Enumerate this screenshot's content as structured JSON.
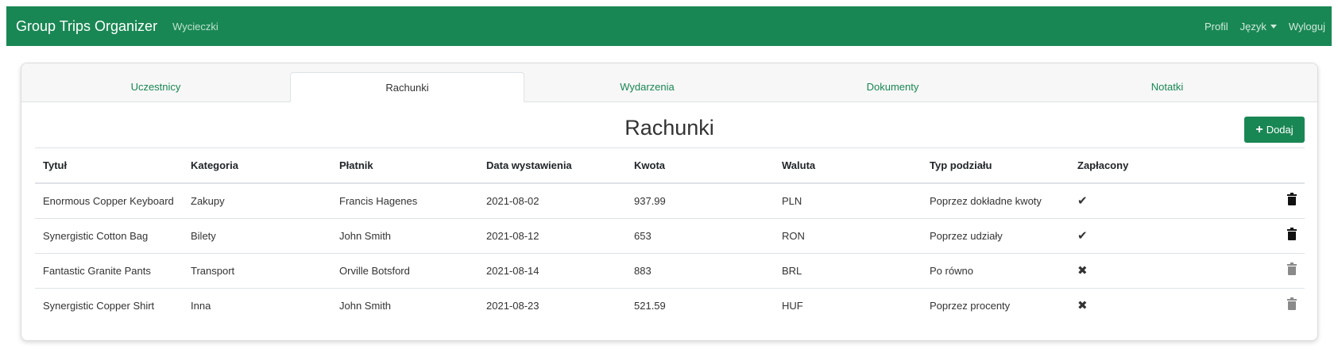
{
  "navbar": {
    "brand": "Group Trips Organizer",
    "trips_link": "Wycieczki",
    "profile": "Profil",
    "language": "Język",
    "logout": "Wyloguj"
  },
  "tabs": [
    "Uczestnicy",
    "Rachunki",
    "Wydarzenia",
    "Dokumenty",
    "Notatki"
  ],
  "active_tab": "Rachunki",
  "page": {
    "title": "Rachunki",
    "add_button": "Dodaj"
  },
  "table": {
    "headers": [
      "Tytuł",
      "Kategoria",
      "Płatnik",
      "Data wystawienia",
      "Kwota",
      "Waluta",
      "Typ podziału",
      "Zapłacony"
    ],
    "rows": [
      {
        "title": "Enormous Copper Keyboard",
        "category": "Zakupy",
        "payer": "Francis Hagenes",
        "date": "2021-08-02",
        "amount": "937.99",
        "currency": "PLN",
        "split": "Poprzez dokładne kwoty",
        "paid": "✔",
        "delete_enabled": true
      },
      {
        "title": "Synergistic Cotton Bag",
        "category": "Bilety",
        "payer": "John Smith",
        "date": "2021-08-12",
        "amount": "653",
        "currency": "RON",
        "split": "Poprzez udziały",
        "paid": "✔",
        "delete_enabled": true
      },
      {
        "title": "Fantastic Granite Pants",
        "category": "Transport",
        "payer": "Orville Botsford",
        "date": "2021-08-14",
        "amount": "883",
        "currency": "BRL",
        "split": "Po równo",
        "paid": "✖",
        "delete_enabled": false
      },
      {
        "title": "Synergistic Copper Shirt",
        "category": "Inna",
        "payer": "John Smith",
        "date": "2021-08-23",
        "amount": "521.59",
        "currency": "HUF",
        "split": "Poprzez procenty",
        "paid": "✖",
        "delete_enabled": false
      }
    ]
  },
  "colors": {
    "navbar": "#198754",
    "accent": "#198754"
  },
  "icons": {
    "add": "plus-icon",
    "paid_yes": "check-icon",
    "paid_no": "cross-icon",
    "delete": "trash-icon",
    "language": "chevron-down-icon"
  }
}
